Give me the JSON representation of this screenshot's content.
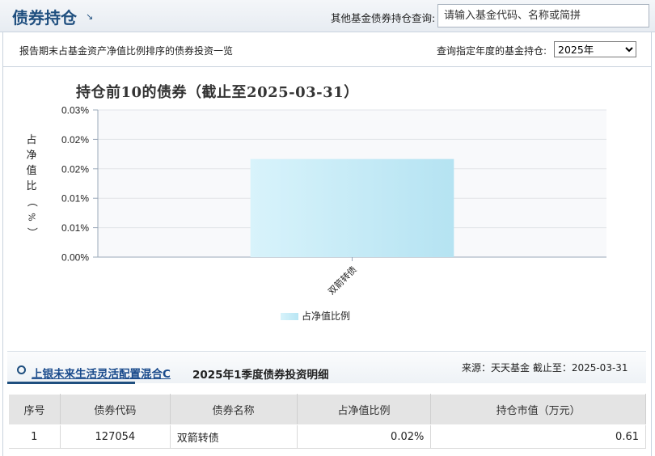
{
  "header": {
    "title": "债券持仓",
    "title_icon": "arrow-down-right-icon",
    "query_label": "其他基金债券持仓查询:",
    "search_placeholder": "请输入基金代码、名称或简拼"
  },
  "subheader": {
    "description": "报告期末占基金资产净值比例排序的债券投资一览",
    "year_label": "查询指定年度的基金持仓:",
    "year_selected": "2025年"
  },
  "chart_data": {
    "type": "bar",
    "title": "持仓前10的债券（截止至2025-03-31）",
    "ylabel": "占净值比（%）",
    "categories": [
      "双箭转债"
    ],
    "series": [
      {
        "name": "占净值比例",
        "values": [
          0.02
        ]
      }
    ],
    "y_ticks": [
      "0.03%",
      "0.02%",
      "0.02%",
      "0.01%",
      "0.01%",
      "0.00%"
    ],
    "ylim": [
      0,
      0.03
    ],
    "legend": "bottom-center",
    "bar_color": "#c6ecf8"
  },
  "detail": {
    "fund_name": "上银未来生活灵活配置混合C",
    "period": "2025年1季度债券投资明细",
    "source": "来源：天天基金    截止至：2025-03-31"
  },
  "table": {
    "headers": [
      "序号",
      "债券代码",
      "债券名称",
      "占净值比例",
      "持仓市值（万元）"
    ],
    "rows": [
      [
        "1",
        "127054",
        "双箭转债",
        "0.02%",
        "0.61"
      ]
    ]
  }
}
